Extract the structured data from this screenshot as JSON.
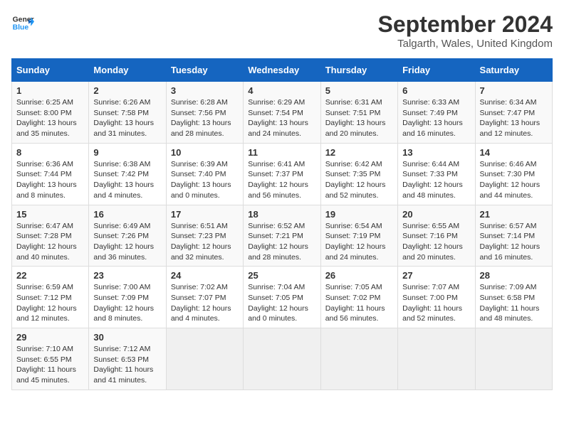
{
  "logo": {
    "line1": "General",
    "line2": "Blue"
  },
  "title": "September 2024",
  "subtitle": "Talgarth, Wales, United Kingdom",
  "days_of_week": [
    "Sunday",
    "Monday",
    "Tuesday",
    "Wednesday",
    "Thursday",
    "Friday",
    "Saturday"
  ],
  "weeks": [
    [
      {
        "day": "1",
        "sunrise": "6:25 AM",
        "sunset": "8:00 PM",
        "daylight": "13 hours and 35 minutes."
      },
      {
        "day": "2",
        "sunrise": "6:26 AM",
        "sunset": "7:58 PM",
        "daylight": "13 hours and 31 minutes."
      },
      {
        "day": "3",
        "sunrise": "6:28 AM",
        "sunset": "7:56 PM",
        "daylight": "13 hours and 28 minutes."
      },
      {
        "day": "4",
        "sunrise": "6:29 AM",
        "sunset": "7:54 PM",
        "daylight": "13 hours and 24 minutes."
      },
      {
        "day": "5",
        "sunrise": "6:31 AM",
        "sunset": "7:51 PM",
        "daylight": "13 hours and 20 minutes."
      },
      {
        "day": "6",
        "sunrise": "6:33 AM",
        "sunset": "7:49 PM",
        "daylight": "13 hours and 16 minutes."
      },
      {
        "day": "7",
        "sunrise": "6:34 AM",
        "sunset": "7:47 PM",
        "daylight": "13 hours and 12 minutes."
      }
    ],
    [
      {
        "day": "8",
        "sunrise": "6:36 AM",
        "sunset": "7:44 PM",
        "daylight": "13 hours and 8 minutes."
      },
      {
        "day": "9",
        "sunrise": "6:38 AM",
        "sunset": "7:42 PM",
        "daylight": "13 hours and 4 minutes."
      },
      {
        "day": "10",
        "sunrise": "6:39 AM",
        "sunset": "7:40 PM",
        "daylight": "13 hours and 0 minutes."
      },
      {
        "day": "11",
        "sunrise": "6:41 AM",
        "sunset": "7:37 PM",
        "daylight": "12 hours and 56 minutes."
      },
      {
        "day": "12",
        "sunrise": "6:42 AM",
        "sunset": "7:35 PM",
        "daylight": "12 hours and 52 minutes."
      },
      {
        "day": "13",
        "sunrise": "6:44 AM",
        "sunset": "7:33 PM",
        "daylight": "12 hours and 48 minutes."
      },
      {
        "day": "14",
        "sunrise": "6:46 AM",
        "sunset": "7:30 PM",
        "daylight": "12 hours and 44 minutes."
      }
    ],
    [
      {
        "day": "15",
        "sunrise": "6:47 AM",
        "sunset": "7:28 PM",
        "daylight": "12 hours and 40 minutes."
      },
      {
        "day": "16",
        "sunrise": "6:49 AM",
        "sunset": "7:26 PM",
        "daylight": "12 hours and 36 minutes."
      },
      {
        "day": "17",
        "sunrise": "6:51 AM",
        "sunset": "7:23 PM",
        "daylight": "12 hours and 32 minutes."
      },
      {
        "day": "18",
        "sunrise": "6:52 AM",
        "sunset": "7:21 PM",
        "daylight": "12 hours and 28 minutes."
      },
      {
        "day": "19",
        "sunrise": "6:54 AM",
        "sunset": "7:19 PM",
        "daylight": "12 hours and 24 minutes."
      },
      {
        "day": "20",
        "sunrise": "6:55 AM",
        "sunset": "7:16 PM",
        "daylight": "12 hours and 20 minutes."
      },
      {
        "day": "21",
        "sunrise": "6:57 AM",
        "sunset": "7:14 PM",
        "daylight": "12 hours and 16 minutes."
      }
    ],
    [
      {
        "day": "22",
        "sunrise": "6:59 AM",
        "sunset": "7:12 PM",
        "daylight": "12 hours and 12 minutes."
      },
      {
        "day": "23",
        "sunrise": "7:00 AM",
        "sunset": "7:09 PM",
        "daylight": "12 hours and 8 minutes."
      },
      {
        "day": "24",
        "sunrise": "7:02 AM",
        "sunset": "7:07 PM",
        "daylight": "12 hours and 4 minutes."
      },
      {
        "day": "25",
        "sunrise": "7:04 AM",
        "sunset": "7:05 PM",
        "daylight": "12 hours and 0 minutes."
      },
      {
        "day": "26",
        "sunrise": "7:05 AM",
        "sunset": "7:02 PM",
        "daylight": "11 hours and 56 minutes."
      },
      {
        "day": "27",
        "sunrise": "7:07 AM",
        "sunset": "7:00 PM",
        "daylight": "11 hours and 52 minutes."
      },
      {
        "day": "28",
        "sunrise": "7:09 AM",
        "sunset": "6:58 PM",
        "daylight": "11 hours and 48 minutes."
      }
    ],
    [
      {
        "day": "29",
        "sunrise": "7:10 AM",
        "sunset": "6:55 PM",
        "daylight": "11 hours and 45 minutes."
      },
      {
        "day": "30",
        "sunrise": "7:12 AM",
        "sunset": "6:53 PM",
        "daylight": "11 hours and 41 minutes."
      },
      null,
      null,
      null,
      null,
      null
    ]
  ],
  "labels": {
    "sunrise": "Sunrise:",
    "sunset": "Sunset:",
    "daylight": "Daylight:"
  }
}
